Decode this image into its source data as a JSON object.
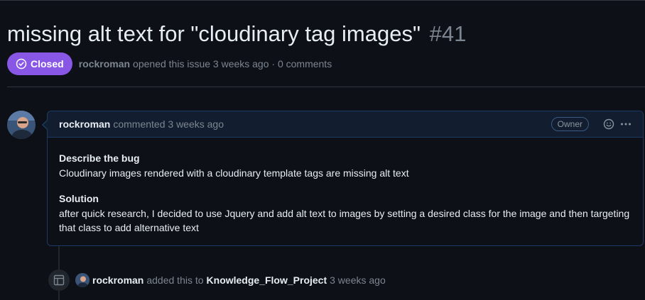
{
  "issue": {
    "title": "missing alt text for \"cloudinary tag images\"",
    "number": "#41",
    "state": "Closed",
    "author": "rockroman",
    "meta": "opened this issue 3 weeks ago · 0 comments"
  },
  "comment": {
    "author": "rockroman",
    "time": "commented 3 weeks ago",
    "role_badge": "Owner",
    "sections": [
      {
        "heading": "Describe the bug",
        "text": "Cloudinary images rendered with a cloudinary template tags are missing alt text"
      },
      {
        "heading": "Solution",
        "text": "after quick research, I decided to use Jquery and add alt text to images by setting a desired class for the image and then targeting that class to add alternative text"
      }
    ]
  },
  "timeline_event": {
    "author": "rockroman",
    "action": "added this to",
    "project": "Knowledge_Flow_Project",
    "time": "3 weeks ago"
  },
  "colors": {
    "closed_badge": "#8957e5",
    "background": "#0d1117",
    "comment_header": "#121d2f",
    "comment_border": "#1c3a66"
  }
}
